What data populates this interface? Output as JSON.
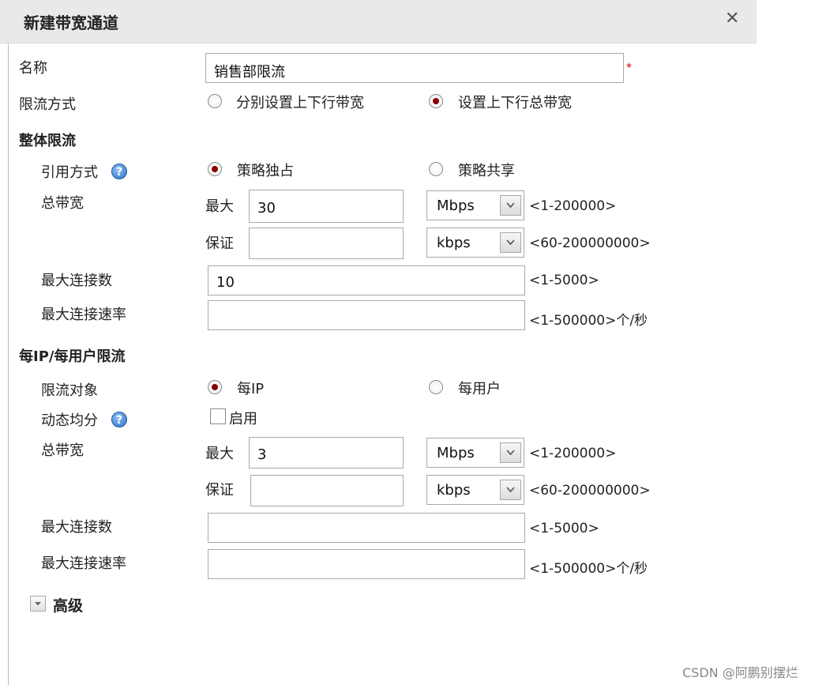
{
  "dialog": {
    "title": "新建带宽通道",
    "close_glyph": "✕"
  },
  "name_field": {
    "label": "名称",
    "value": "销售部限流",
    "required_mark": "*"
  },
  "limit_mode": {
    "label": "限流方式",
    "options": [
      "分别设置上下行带宽",
      "设置上下行总带宽"
    ],
    "selected": "设置上下行总带宽"
  },
  "overall": {
    "section_title": "整体限流",
    "reference": {
      "label": "引用方式",
      "help_icon": "help-icon",
      "options": [
        "策略独占",
        "策略共享"
      ],
      "selected": "策略独占"
    },
    "bandwidth": {
      "label": "总带宽",
      "max_label": "最大",
      "max_value": "30",
      "max_unit": "Mbps",
      "max_hint": "<1-200000>",
      "guarantee_label": "保证",
      "guarantee_value": "",
      "guarantee_unit": "kbps",
      "guarantee_hint": "<60-200000000>"
    },
    "max_conn": {
      "label": "最大连接数",
      "value": "10",
      "hint": "<1-5000>"
    },
    "max_conn_rate": {
      "label": "最大连接速率",
      "value": "",
      "hint": "<1-500000>个/秒"
    }
  },
  "per_ip": {
    "section_title": "每IP/每用户限流",
    "target": {
      "label": "限流对象",
      "options": [
        "每IP",
        "每用户"
      ],
      "selected": "每IP"
    },
    "dynamic": {
      "label": "动态均分",
      "help_icon": "help-icon",
      "checkbox_label": "启用",
      "checked": false
    },
    "bandwidth": {
      "label": "总带宽",
      "max_label": "最大",
      "max_value": "3",
      "max_unit": "Mbps",
      "max_hint": "<1-200000>",
      "guarantee_label": "保证",
      "guarantee_value": "",
      "guarantee_unit": "kbps",
      "guarantee_hint": "<60-200000000>"
    },
    "max_conn": {
      "label": "最大连接数",
      "value": "",
      "hint": "<1-5000>"
    },
    "max_conn_rate": {
      "label": "最大连接速率",
      "value": "",
      "hint": "<1-500000>个/秒"
    }
  },
  "advanced": {
    "label": "高级",
    "icon": "expand-toggle-icon"
  },
  "watermark": "CSDN @阿鹏别摆烂",
  "colors": {
    "radio_selected": "#8b0000",
    "required_star": "#cc0000",
    "titlebar_bg": "#e9e9e9"
  }
}
